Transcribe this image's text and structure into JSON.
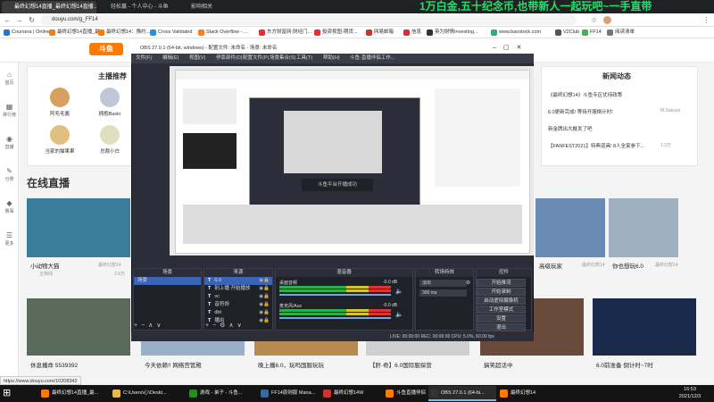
{
  "browser": {
    "tabs": [
      {
        "label": "最终幻想14直播_最终幻想14直播...",
        "color": "#ff7a00",
        "active": true
      },
      {
        "label": "轻松赢 - 个人中心 - 斗鱼",
        "color": "#ff7a00",
        "active": false
      },
      {
        "label": "影响相关",
        "color": "#ff7a00",
        "active": false
      }
    ],
    "marquee": "1万白金,五十纪念币,也带新人一起玩吧~一手直带",
    "url": "douyu.com/g_FF14",
    "bookmarks": [
      {
        "label": "Coursera | Online ...",
        "color": "#2a73cc"
      },
      {
        "label": "最终幻想14直播_最...",
        "color": "#ff7a00"
      },
      {
        "label": "最终幻想14：豫约...",
        "color": "#ff7a00"
      },
      {
        "label": "Cross Validated",
        "color": "#2b90d9"
      },
      {
        "label": "Stack Overflow - ...",
        "color": "#f48024"
      },
      {
        "label": "东方财富网:财经门...",
        "color": "#d33"
      },
      {
        "label": "投资视图-期货...",
        "color": "#d33"
      },
      {
        "label": "网易邮箱",
        "color": "#c33"
      },
      {
        "label": "信息",
        "color": "#c33"
      },
      {
        "label": "英为财情Investing...",
        "color": "#333"
      },
      {
        "label": "www.baostock.com",
        "color": "#3a7"
      },
      {
        "label": "V2Club",
        "color": "#555"
      },
      {
        "label": "FF14",
        "color": "#5a5"
      },
      {
        "label": "阅读清单",
        "color": "#777"
      }
    ]
  },
  "page": {
    "logo": "斗鱼",
    "sidebar": [
      {
        "icon": "⌂",
        "label": "首页"
      },
      {
        "icon": "▦",
        "label": "排行榜"
      },
      {
        "icon": "◉",
        "label": "直播"
      },
      {
        "icon": "✎",
        "label": "分类"
      },
      {
        "icon": "◆",
        "label": "赛事"
      },
      {
        "icon": "☰",
        "label": "更多"
      }
    ],
    "recommend": {
      "title": "主播推荐",
      "anchors": [
        {
          "name": "阿毛毛酱",
          "color": "#d8a060"
        },
        {
          "name": "拥抱Basin",
          "color": "#c0c8d8"
        },
        {
          "name": "当家的猫果果",
          "color": "#e0c080"
        },
        {
          "name": "总裁小白",
          "color": "#e0e0c0"
        }
      ]
    },
    "news": {
      "title": "新闻动态",
      "items": [
        {
          "text": "《最终幻想14》斗鱼专区优待政策",
          "meta": ""
        },
        {
          "text": "6.0更新完成! 等待开服倒计时!",
          "meta": "M.Sakuya"
        },
        {
          "text": "新金牌出大概发了吧",
          "meta": ""
        },
        {
          "text": "【FANFEST2021】特典道具! 8人全家参下...",
          "meta": "1.3万"
        }
      ]
    },
    "live_title": "在线直播",
    "right_cards": [
      {
        "title": "高级玩家",
        "sub": "最终幻想14",
        "color": "#6a8bb4"
      },
      {
        "title": "你也想玩6.0",
        "sub": "最终幻想14",
        "color": "#a0b0c0"
      }
    ],
    "rooms_top": [
      {
        "title": "小动物大猫",
        "sub": "最终幻想14",
        "host": "五档线",
        "views": "2.6万",
        "color": "#3a7c9a"
      }
    ],
    "rooms_bottom": [
      {
        "title": "休息播命 5539392",
        "color": "#5a6a5a"
      },
      {
        "title": "今天依赖!! 网络宫管殿",
        "color": "#9ab0c8"
      },
      {
        "title": "晚上播6.0，玩吗国服玩玩",
        "color": "#b88a50"
      },
      {
        "title": "【肝·奇】6.0国际服探营",
        "color": "#d0d0d0"
      },
      {
        "title": "搞笑超话中",
        "color": "#6a4a3a"
      },
      {
        "title": "6.0前准备 倒计时~7时",
        "color": "#1a2a4a"
      }
    ],
    "status_link": "https://www.douyu.com/10208342"
  },
  "obs": {
    "title": "OBS 27.0.1 (64-bit, windows) - 配置文件: 未命名 - 场景: 未命名",
    "menu": [
      "文件(F)",
      "编辑(E)",
      "视图(V)",
      "停靠部件(D)",
      "配置文件(P)",
      "场景集合(S)",
      "工具(T)",
      "帮助(H)",
      "斗鱼-直播伴侣工作..."
    ],
    "scenes_header": "场景",
    "scene_items": [
      "场景"
    ],
    "sources_header": "来源",
    "source_items": [
      "6.0",
      "别上播 开始播放",
      "vc",
      "音符饰",
      "dbt",
      "播出"
    ],
    "mixer_header": "混音器",
    "mixer": [
      {
        "name": "桌面音频",
        "db": "-0.0 dB"
      },
      {
        "name": "麦克风/Aux",
        "db": "-0.0 dB"
      }
    ],
    "transitions_header": "转场特效",
    "transition": "淡出",
    "duration": "300 ms",
    "controls_header": "控件",
    "controls": [
      "开始推流",
      "开始录制",
      "启动虚拟摄像机",
      "工作室模式",
      "设置",
      "退出"
    ],
    "status": "LIVE: 00:00:00   REC: 00:00:00   CPU: 5.0%, 60.00 fps",
    "preview_label": "斗鱼平台开播成功"
  },
  "taskbar": {
    "items": [
      {
        "label": "最终幻想14直播_最...",
        "color": "#ff7a00"
      },
      {
        "label": "C:\\Users\\心\\Deskt...",
        "color": "#e8b84a"
      },
      {
        "label": "游戏 - 弟子 - 斗鱼...",
        "color": "#2a8a2a"
      },
      {
        "label": "FF14原则版 Mana...",
        "color": "#3a6a9a"
      },
      {
        "label": "最终幻想14W",
        "color": "#c33"
      },
      {
        "label": "斗鱼直播伴侣",
        "color": "#ff7a00"
      },
      {
        "label": "OBS 27.0.1 (64-bi...",
        "color": "#333"
      },
      {
        "label": "最终幻想14",
        "color": "#ff7a00"
      }
    ],
    "time": "16:53",
    "date": "2021/12/3"
  }
}
